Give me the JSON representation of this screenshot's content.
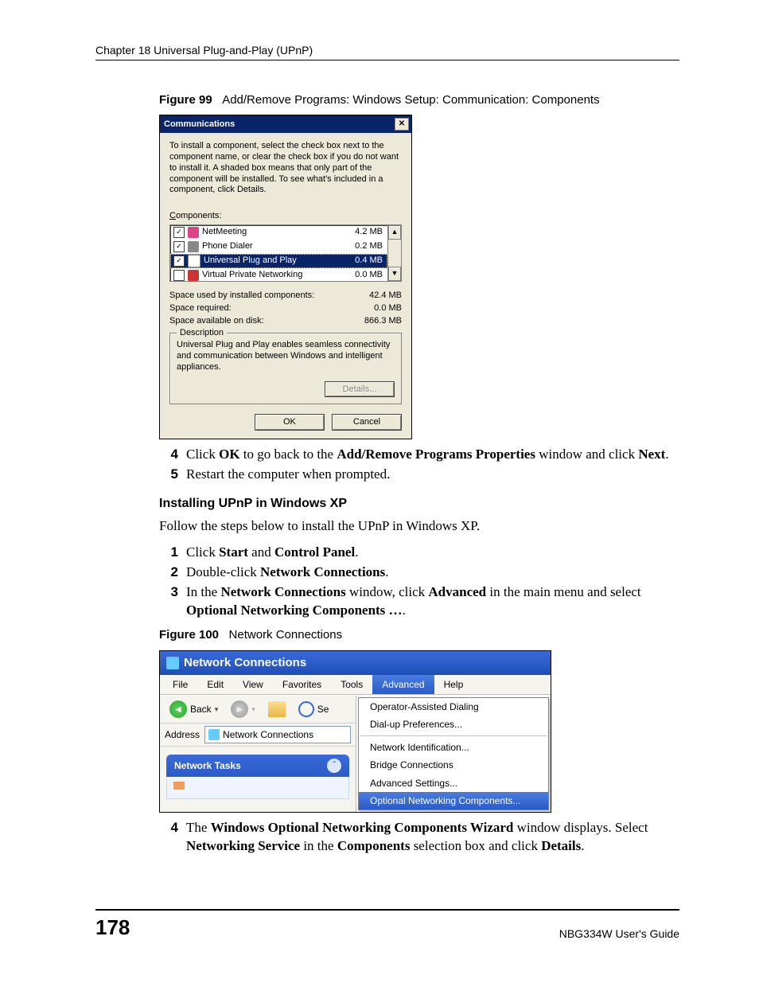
{
  "header": {
    "chapter": "Chapter 18 Universal Plug-and-Play (UPnP)"
  },
  "fig99": {
    "caption_num": "Figure 99",
    "caption_text": "Add/Remove Programs: Windows Setup: Communication: Components",
    "title": "Communications",
    "instructions": "To install a component, select the check box next to the component name, or clear the check box if you do not want to install it. A shaded box means that only part of the component will be installed. To see what's included in a component, click Details.",
    "components_label": "Components:",
    "items": [
      {
        "name": "NetMeeting",
        "size": "4.2 MB",
        "checked": true,
        "selected": false
      },
      {
        "name": "Phone Dialer",
        "size": "0.2 MB",
        "checked": true,
        "selected": false
      },
      {
        "name": "Universal Plug and Play",
        "size": "0.4 MB",
        "checked": true,
        "selected": true
      },
      {
        "name": "Virtual Private Networking",
        "size": "0.0 MB",
        "checked": false,
        "selected": false
      }
    ],
    "stats": {
      "space_used_label": "Space used by installed components:",
      "space_used": "42.4 MB",
      "space_req_label": "Space required:",
      "space_req": "0.0 MB",
      "space_avail_label": "Space available on disk:",
      "space_avail": "866.3 MB"
    },
    "desc_legend": "Description",
    "desc_text": "Universal Plug and Play enables seamless connectivity and communication between Windows and intelligent appliances.",
    "details_btn": "Details...",
    "ok_btn": "OK",
    "cancel_btn": "Cancel"
  },
  "stepsA": {
    "s4_pre": "Click ",
    "s4_b1": "OK",
    "s4_mid": " to go back to the ",
    "s4_b2": "Add/Remove Programs Properties",
    "s4_mid2": " window and click ",
    "s4_b3": "Next",
    "s4_end": ".",
    "s5": "Restart the computer when prompted."
  },
  "xp_heading": "Installing UPnP in Windows XP",
  "xp_intro": "Follow the steps below to install the UPnP in Windows XP.",
  "stepsB": {
    "s1_pre": "Click ",
    "s1_b1": "Start",
    "s1_mid": " and ",
    "s1_b2": "Control Panel",
    "s1_end": ".",
    "s2_pre": "Double-click ",
    "s2_b1": "Network Connections",
    "s2_end": ".",
    "s3_pre": "In the ",
    "s3_b1": "Network Connections",
    "s3_mid": " window, click ",
    "s3_b2": "Advanced",
    "s3_mid2": " in the main menu and select ",
    "s3_b3": "Optional Networking Components …",
    "s3_end": "."
  },
  "fig100": {
    "caption_num": "Figure 100",
    "caption_text": "Network Connections",
    "title": "Network Connections",
    "menu": [
      "File",
      "Edit",
      "View",
      "Favorites",
      "Tools",
      "Advanced",
      "Help"
    ],
    "menu_selected": "Advanced",
    "toolbar": {
      "back": "Back",
      "search_hint": "Se"
    },
    "addr_label": "Address",
    "addr_value": "Network Connections",
    "tasks_title": "Network Tasks",
    "dropdown": [
      "Operator-Assisted Dialing",
      "Dial-up Preferences...",
      "---",
      "Network Identification...",
      "Bridge Connections",
      "Advanced Settings...",
      "Optional Networking Components..."
    ],
    "dropdown_selected": "Optional Networking Components..."
  },
  "stepsC": {
    "s4_pre": "The ",
    "s4_b1": "Windows Optional Networking Components Wizard",
    "s4_mid": " window displays. Select ",
    "s4_b2": "Networking Service",
    "s4_mid2": " in the ",
    "s4_b3": "Components",
    "s4_mid3": " selection box and click ",
    "s4_b4": "Details",
    "s4_end": "."
  },
  "footer": {
    "page": "178",
    "guide": "NBG334W User's Guide"
  }
}
